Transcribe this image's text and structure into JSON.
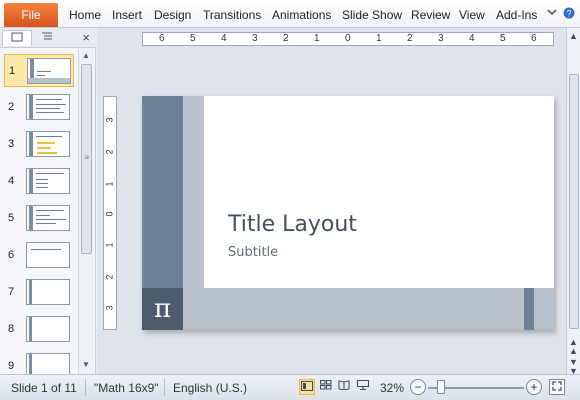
{
  "ribbon": {
    "file_label": "File",
    "tabs": [
      "Home",
      "Insert",
      "Design",
      "Transitions",
      "Animations",
      "Slide Show",
      "Review",
      "View",
      "Add-Ins"
    ],
    "icons": [
      "minimize-ribbon-icon",
      "help-icon"
    ]
  },
  "left_pane": {
    "tabs": [
      "slides-tab-icon",
      "outline-tab-icon"
    ],
    "close_symbol": "×",
    "thumbnails": [
      {
        "number": "1",
        "selected": true
      },
      {
        "number": "2",
        "selected": false
      },
      {
        "number": "3",
        "selected": false
      },
      {
        "number": "4",
        "selected": false
      },
      {
        "number": "5",
        "selected": false
      },
      {
        "number": "6",
        "selected": false
      },
      {
        "number": "7",
        "selected": false
      },
      {
        "number": "8",
        "selected": false
      },
      {
        "number": "9",
        "selected": false
      }
    ]
  },
  "rulers": {
    "horizontal": [
      "6",
      "5",
      "4",
      "3",
      "2",
      "1",
      "0",
      "1",
      "2",
      "3",
      "4",
      "5",
      "6"
    ],
    "vertical": [
      "3",
      "2",
      "1",
      "0",
      "1",
      "2",
      "3"
    ]
  },
  "slide": {
    "title": "Title Layout",
    "subtitle": "Subtitle",
    "symbol": "π",
    "colors": {
      "dark_band": "#6f8196",
      "light_band": "#b7c1cc",
      "symbol_box": "#4c5c6e"
    }
  },
  "status": {
    "slide_info": "Slide 1 of 11",
    "theme": "\"Math 16x9\"",
    "language": "English (U.S.)",
    "zoom": "32%",
    "zoom_level": 0.32,
    "view_buttons": [
      "normal-view-icon",
      "slide-sorter-icon",
      "reading-view-icon",
      "slide-show-icon"
    ]
  }
}
